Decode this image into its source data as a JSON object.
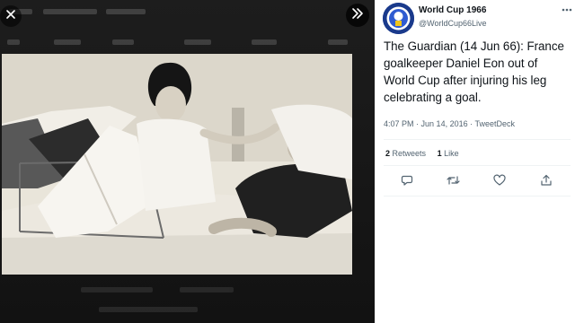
{
  "tweet": {
    "author_name": "World Cup 1966",
    "author_handle": "@WorldCup66Live",
    "text": "The Guardian (14 Jun 66): France goalkeeper Daniel Eon out of World Cup after injuring his leg celebrating a goal.",
    "time": "4:07 PM",
    "date": "Jun 14, 2016",
    "separator": "·",
    "source": "TweetDeck",
    "retweets_count": "2",
    "retweets_label": "Retweets",
    "likes_count": "1",
    "likes_label": "Like"
  },
  "media": {
    "close_icon": "close-icon",
    "expand_icon": "chevron-double-right-icon"
  },
  "icons": {
    "reply": "reply-icon",
    "retweet": "retweet-icon",
    "like": "heart-icon",
    "share": "share-icon",
    "more": "more-icon"
  },
  "colors": {
    "text_primary": "#0f1419",
    "text_secondary": "#536471",
    "divider": "#eff3f4",
    "media_background": "#151515",
    "avatar_background": "#1a3a8c"
  }
}
